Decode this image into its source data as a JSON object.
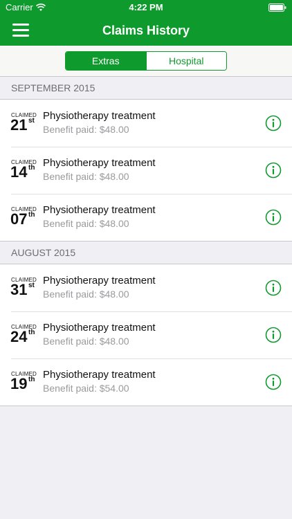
{
  "status_bar": {
    "carrier": "Carrier",
    "time": "4:22 PM"
  },
  "nav": {
    "title": "Claims History"
  },
  "segments": [
    {
      "label": "Extras",
      "active": true
    },
    {
      "label": "Hospital",
      "active": false
    }
  ],
  "colors": {
    "brand": "#0f9a2d",
    "subtext": "#9a9a9e"
  },
  "sections": [
    {
      "header": "SEPTEMBER 2015",
      "rows": [
        {
          "claimed": "CLAIMED",
          "day": "21",
          "suffix": "st",
          "title": "Physiotherapy treatment",
          "benefit": "Benefit paid: $48.00"
        },
        {
          "claimed": "CLAIMED",
          "day": "14",
          "suffix": "th",
          "title": "Physiotherapy treatment",
          "benefit": "Benefit paid: $48.00"
        },
        {
          "claimed": "CLAIMED",
          "day": "07",
          "suffix": "th",
          "title": "Physiotherapy treatment",
          "benefit": "Benefit paid: $48.00"
        }
      ]
    },
    {
      "header": "AUGUST 2015",
      "rows": [
        {
          "claimed": "CLAIMED",
          "day": "31",
          "suffix": "st",
          "title": "Physiotherapy treatment",
          "benefit": "Benefit paid: $48.00"
        },
        {
          "claimed": "CLAIMED",
          "day": "24",
          "suffix": "th",
          "title": "Physiotherapy treatment",
          "benefit": "Benefit paid: $48.00"
        },
        {
          "claimed": "CLAIMED",
          "day": "19",
          "suffix": "th",
          "title": "Physiotherapy treatment",
          "benefit": "Benefit paid: $54.00"
        }
      ]
    }
  ],
  "icons": {
    "menu": "hamburger-menu-icon",
    "info": "info-circle-icon",
    "wifi": "wifi-icon",
    "battery": "battery-icon"
  }
}
